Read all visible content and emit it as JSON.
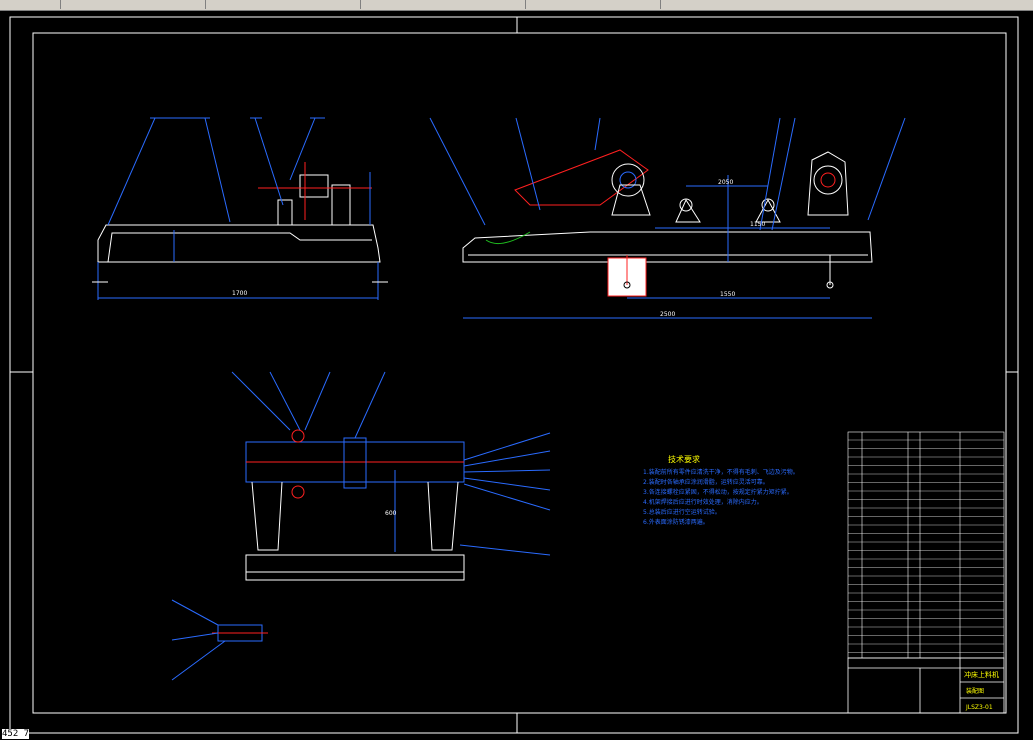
{
  "topbar": {
    "tabs": [
      "",
      "",
      "",
      "",
      "",
      ""
    ]
  },
  "status": {
    "coord": "452 7"
  },
  "drawing": {
    "dims": {
      "left_length": "1700",
      "right_length": "2500",
      "right_sub": "1550",
      "center_span": "1150",
      "top_span": "2050",
      "section_height": "600"
    },
    "notes_title": "技术要求",
    "notes": [
      "1.装配前所有零件应清洗干净，不得有毛刺、飞边及污物。",
      "2.装配时各轴承应涂润滑脂，运转应灵活可靠。",
      "3.各连接螺栓应紧固，不得松动，按规定拧紧力矩拧紧。",
      "4.机架焊接后应进行时效处理，消除内应力。",
      "5.总装后应进行空运转试验。",
      "6.外表面涂防锈漆两遍。"
    ],
    "title_block": {
      "title": "冲床上料机",
      "drawing_no": "JLSZ3-01",
      "company": "装配图"
    }
  },
  "colors": {
    "bg": "#000000",
    "frame": "#ffffff",
    "blue": "#2a6bff",
    "red": "#ff2020",
    "yellow": "#ffff00",
    "green": "#20c020"
  }
}
